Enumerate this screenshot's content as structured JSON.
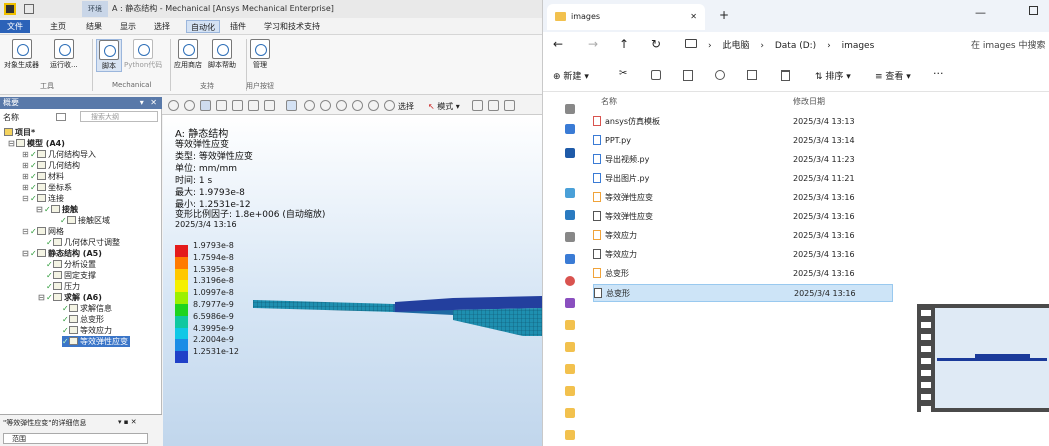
{
  "ansys": {
    "title": "A : 静态结构 - Mechanical [Ansys Mechanical Enterprise]",
    "context_tab": "环境",
    "menus": [
      "文件",
      "主页",
      "结果",
      "显示",
      "选择",
      "自动化",
      "插件",
      "学习和技术支持"
    ],
    "ribbon": {
      "buttons": [
        "对象生成器",
        "运行收...",
        "脚本",
        "Python代码",
        "应用商店",
        "脚本帮助",
        "管理"
      ],
      "groups": [
        "工具",
        "Mechanical",
        "支持",
        "用户按钮"
      ]
    },
    "tree": {
      "panel_title": "概要",
      "name_label": "名称",
      "search_placeholder": "搜索大纲",
      "items": [
        "项目*",
        "模型 (A4)",
        "几何结构导入",
        "几何结构",
        "材料",
        "坐标系",
        "连接",
        "接触",
        "接触区域",
        "网格",
        "几何体尺寸调整",
        "静态结构 (A5)",
        "分析设置",
        "固定支撑",
        "压力",
        "求解 (A6)",
        "求解信息",
        "总变形",
        "等效应力",
        "等效弹性应变"
      ],
      "details_title": "\"等效弹性应变\"的详细信息",
      "details_row": "范围"
    },
    "toolbar": {
      "select_label": "选择",
      "mode_label": "模式"
    },
    "viewport": {
      "title": "A: 静态结构",
      "result": "等效弹性应变",
      "type": "类型: 等效弹性应变",
      "unit": "单位: mm/mm",
      "time": "时间: 1 s",
      "max": "最大: 1.9793e-8",
      "min": "最小: 1.2531e-12",
      "scale": "变形比例因子: 1.8e+006 (自动缩放)",
      "date": "2025/3/4 13:16",
      "legend": [
        "1.9793e-8",
        "1.7594e-8",
        "1.5395e-8",
        "1.3196e-8",
        "1.0997e-8",
        "8.7977e-9",
        "6.5986e-9",
        "4.3995e-9",
        "2.2004e-9",
        "1.2531e-12"
      ],
      "legend_colors": [
        "#e41b1b",
        "#ff7a00",
        "#ffc800",
        "#f5f000",
        "#9cf000",
        "#1ed41e",
        "#10c8a0",
        "#10c8e6",
        "#1a8ce6",
        "#2040c8"
      ]
    }
  },
  "explorer": {
    "tab_title": "images",
    "path": [
      "此电脑",
      "Data (D:)",
      "images"
    ],
    "search_placeholder": "在 images 中搜索",
    "commands": {
      "new": "新建",
      "sort": "排序",
      "view": "查看"
    },
    "columns": {
      "name": "名称",
      "date": "修改日期"
    },
    "files": [
      {
        "name": "ansys仿真模板",
        "date": "2025/3/4 13:13"
      },
      {
        "name": "PPT.py",
        "date": "2025/3/4 13:14"
      },
      {
        "name": "导出视频.py",
        "date": "2025/3/4 11:23"
      },
      {
        "name": "导出图片.py",
        "date": "2025/3/4 11:21"
      },
      {
        "name": "等效弹性应变",
        "date": "2025/3/4 13:16"
      },
      {
        "name": "等效弹性应变",
        "date": "2025/3/4 13:16"
      },
      {
        "name": "等效应力",
        "date": "2025/3/4 13:16"
      },
      {
        "name": "等效应力",
        "date": "2025/3/4 13:16"
      },
      {
        "name": "总变形",
        "date": "2025/3/4 13:16"
      },
      {
        "name": "总变形",
        "date": "2025/3/4 13:16"
      }
    ]
  }
}
